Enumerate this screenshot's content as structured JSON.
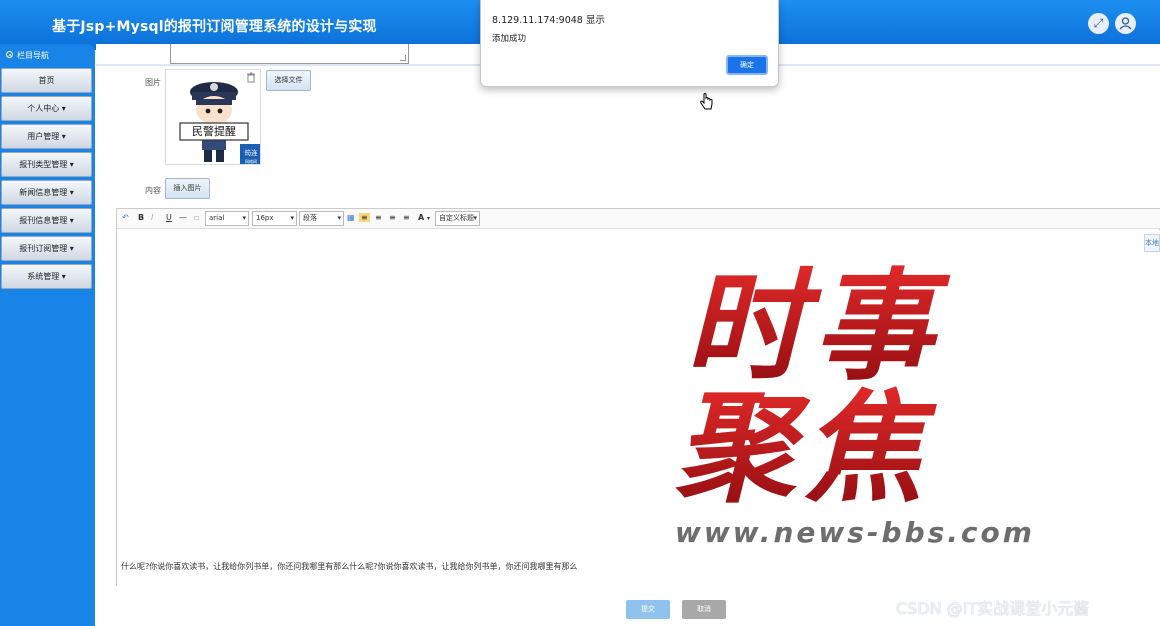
{
  "header": {
    "title": "基于Jsp+Mysql的报刊订阅管理系统的设计与实现",
    "fullscreen_icon": "fullscreen-icon",
    "user_icon": "user-icon"
  },
  "sidebar": {
    "title": "栏目导航",
    "items": [
      {
        "label": "首页"
      },
      {
        "label": "个人中心 ▾"
      },
      {
        "label": "用户管理 ▾"
      },
      {
        "label": "报刊类型管理 ▾"
      },
      {
        "label": "新闻信息管理 ▾"
      },
      {
        "label": "报刊信息管理 ▾"
      },
      {
        "label": "报刊订阅管理 ▾"
      },
      {
        "label": "系统管理 ▾"
      }
    ]
  },
  "form": {
    "image_label": "图片",
    "choose_file_label": "选择文件",
    "content_label": "内容",
    "insert_image_label": "插入图片",
    "preview_caption": "民警提醒",
    "preview_badge": "筠连",
    "preview_badge_sub": "网络网"
  },
  "editor": {
    "toolbar": {
      "font": "arial",
      "size": "16px",
      "paragraph": "段落",
      "custom_title": "自定义标题",
      "bold": "B",
      "italic": "I",
      "underline": "U",
      "font_color": "A"
    },
    "side_tag": "本地",
    "banner": {
      "line1": "时事",
      "line2": "聚焦",
      "url": "www.news-bbs.com"
    },
    "content_text": "什么呢?你说你喜欢读书，让我给你列书单，你还问我哪里有那么什么呢?你说你喜欢读书，让我给你列书单，你还问我哪里有那么"
  },
  "footer": {
    "submit_label": "提交",
    "cancel_label": "取消"
  },
  "dialog": {
    "origin": "8.129.11.174:9048 显示",
    "message": "添加成功",
    "ok_label": "确定"
  },
  "watermark": "CSDN @IT实战课堂小元酱",
  "colors": {
    "header": "#1d8ff0",
    "sidebar": "#1884e8",
    "dialog_button": "#1a73e8",
    "banner_red": "#c4161c"
  }
}
